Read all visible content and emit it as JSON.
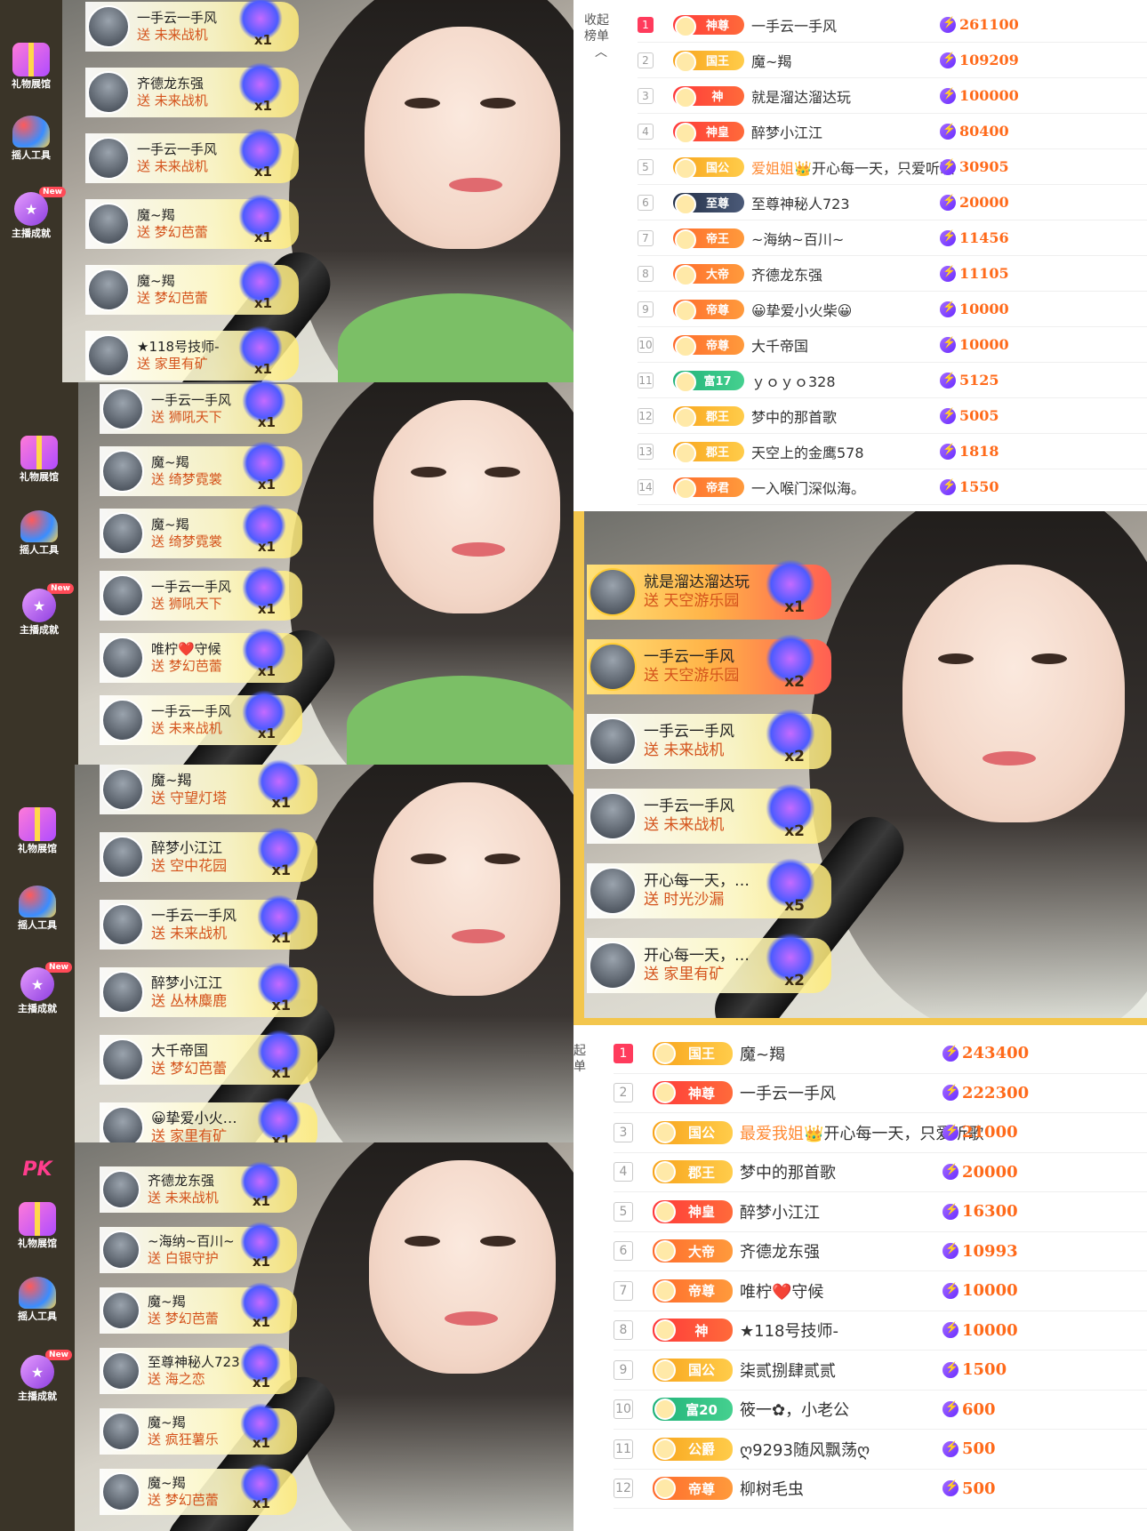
{
  "sidebar": {
    "gift_hall": "礼物展馆",
    "tools": "摇人工具",
    "achievement": "主播成就",
    "new_badge": "New",
    "pk": "PK"
  },
  "rank_panel_top": {
    "collapse_label": "收起\n榜单",
    "rows": [
      {
        "rank": "1",
        "badge": "神尊",
        "name": "一手云一手风",
        "score": "261100"
      },
      {
        "rank": "2",
        "badge": "国王",
        "name": "魔~羯",
        "score": "109209"
      },
      {
        "rank": "3",
        "badge": "神",
        "name": "就是溜达溜达玩",
        "score": "100000"
      },
      {
        "rank": "4",
        "badge": "神皇",
        "name": "醉梦小江江",
        "score": "80400"
      },
      {
        "rank": "5",
        "badge": "国公",
        "name_hl": "爱姐姐",
        "name": "👑开心每一天，只爱听歌",
        "score": "30905"
      },
      {
        "rank": "6",
        "badge": "至尊",
        "name": "至尊神秘人723",
        "score": "20000"
      },
      {
        "rank": "7",
        "badge": "帝王",
        "name": "~海纳~百川~",
        "score": "11456"
      },
      {
        "rank": "8",
        "badge": "大帝",
        "name": "齐德龙东强",
        "score": "11105"
      },
      {
        "rank": "9",
        "badge": "帝尊",
        "name": "😀挚爱小火柴😀",
        "score": "10000"
      },
      {
        "rank": "10",
        "badge": "帝尊",
        "name": "大千帝国",
        "score": "10000"
      },
      {
        "rank": "11",
        "badge": "富17",
        "name": "ｙｏｙｏ328",
        "score": "5125"
      },
      {
        "rank": "12",
        "badge": "郡王",
        "name": "梦中的那首歌",
        "score": "5005"
      },
      {
        "rank": "13",
        "badge": "郡王",
        "name": "天空上的金鹰578",
        "score": "1818"
      },
      {
        "rank": "14",
        "badge": "帝君",
        "name": "一入喉门深似海。",
        "score": "1550"
      }
    ]
  },
  "rank_panel_bottom": {
    "collapse_label": "起\n单",
    "rows": [
      {
        "rank": "1",
        "badge": "国王",
        "name": "魔~羯",
        "score": "243400"
      },
      {
        "rank": "2",
        "badge": "神尊",
        "name": "一手云一手风",
        "score": "222300"
      },
      {
        "rank": "3",
        "badge": "国公",
        "name_hl": "最爱我姐",
        "name": "👑开心每一天，只爱听歌",
        "score": "21000"
      },
      {
        "rank": "4",
        "badge": "郡王",
        "name": "梦中的那首歌",
        "score": "20000"
      },
      {
        "rank": "5",
        "badge": "神皇",
        "name": "醉梦小江江",
        "score": "16300"
      },
      {
        "rank": "6",
        "badge": "大帝",
        "name": "齐德龙东强",
        "score": "10993"
      },
      {
        "rank": "7",
        "badge": "帝尊",
        "name": "唯柠❤️守候",
        "score": "10000"
      },
      {
        "rank": "8",
        "badge": "神",
        "name": "★118号技师-",
        "score": "10000"
      },
      {
        "rank": "9",
        "badge": "国公",
        "name": "柒贰捌肆贰贰",
        "score": "1500"
      },
      {
        "rank": "10",
        "badge": "富20",
        "name": "筱一✿，小老公",
        "score": "600"
      },
      {
        "rank": "11",
        "badge": "公爵",
        "name": "ღ9293随风飘荡ღ",
        "score": "500"
      },
      {
        "rank": "12",
        "badge": "帝尊",
        "name": "柳树毛虫",
        "score": "500"
      }
    ]
  },
  "gifts_a": [
    {
      "user": "一手云一手风",
      "gift": "送 未来战机",
      "count": "x1"
    },
    {
      "user": "齐德龙东强",
      "gift": "送 未来战机",
      "count": "x1"
    },
    {
      "user": "一手云一手风",
      "gift": "送 未来战机",
      "count": "x1"
    },
    {
      "user": "魔~羯",
      "gift": "送 梦幻芭蕾",
      "count": "x1"
    },
    {
      "user": "魔~羯",
      "gift": "送 梦幻芭蕾",
      "count": "x1"
    },
    {
      "user": "★118号技师-",
      "gift": "送 家里有矿",
      "count": "x1"
    }
  ],
  "gifts_b": [
    {
      "user": "一手云一手风",
      "gift": "送 狮吼天下",
      "count": "x1"
    },
    {
      "user": "魔~羯",
      "gift": "送 绮梦霓裳",
      "count": "x1"
    },
    {
      "user": "魔~羯",
      "gift": "送 绮梦霓裳",
      "count": "x1"
    },
    {
      "user": "一手云一手风",
      "gift": "送 狮吼天下",
      "count": "x1"
    },
    {
      "user": "唯柠❤️守候",
      "gift": "送 梦幻芭蕾",
      "count": "x1"
    },
    {
      "user": "一手云一手风",
      "gift": "送 未来战机",
      "count": "x1"
    }
  ],
  "gifts_c": [
    {
      "user": "魔~羯",
      "gift": "送 守望灯塔",
      "count": "x1"
    },
    {
      "user": "醉梦小江江",
      "gift": "送 空中花园",
      "count": "x1"
    },
    {
      "user": "一手云一手风",
      "gift": "送 未来战机",
      "count": "x1"
    },
    {
      "user": "醉梦小江江",
      "gift": "送 丛林麋鹿",
      "count": "x1"
    },
    {
      "user": "大千帝国",
      "gift": "送 梦幻芭蕾",
      "count": "x1"
    },
    {
      "user": "😀挚爱小火…",
      "gift": "送 家里有矿",
      "count": "x1"
    }
  ],
  "gifts_d": [
    {
      "user": "齐德龙东强",
      "gift": "送 未来战机",
      "count": "x1"
    },
    {
      "user": "~海纳~百川~",
      "gift": "送 白银守护",
      "count": "x1"
    },
    {
      "user": "魔~羯",
      "gift": "送 梦幻芭蕾",
      "count": "x1"
    },
    {
      "user": "至尊神秘人723",
      "gift": "送 海之恋",
      "count": "x1"
    },
    {
      "user": "魔~羯",
      "gift": "送 疯狂薯乐",
      "count": "x1"
    },
    {
      "user": "魔~羯",
      "gift": "送 梦幻芭蕾",
      "count": "x1"
    }
  ],
  "gifts_e": [
    {
      "user": "就是溜达溜达玩",
      "gift": "送 天空游乐园",
      "count": "x1"
    },
    {
      "user": "一手云一手风",
      "gift": "送 天空游乐园",
      "count": "x2"
    },
    {
      "user": "一手云一手风",
      "gift": "送 未来战机",
      "count": "x2"
    },
    {
      "user": "一手云一手风",
      "gift": "送 未来战机",
      "count": "x2"
    },
    {
      "user": "开心每一天，…",
      "gift": "送 时光沙漏",
      "count": "x5"
    },
    {
      "user": "开心每一天，…",
      "gift": "送 家里有矿",
      "count": "x2"
    }
  ],
  "colors": {
    "accent": "#ff6a1a",
    "sidebar": "#3a3428",
    "gift_bar": "#ffe27a",
    "rank_one": "#ff3b5c"
  }
}
